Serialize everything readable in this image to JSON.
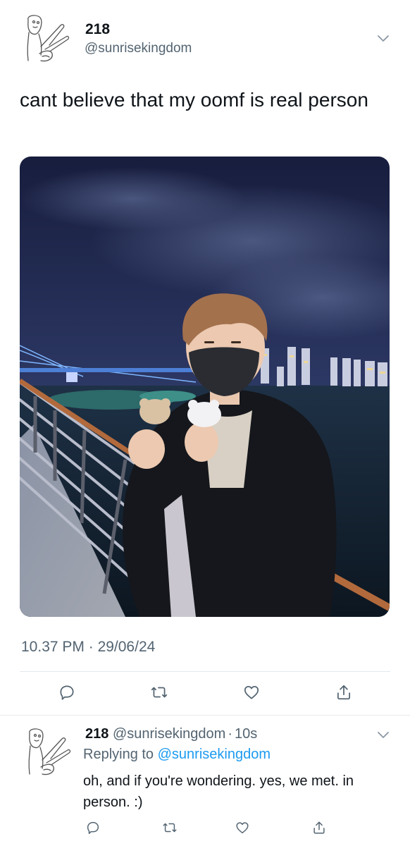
{
  "tweet": {
    "display_name": "218",
    "handle": "@sunrisekingdom",
    "text": "cant believe that my oomf is real person",
    "time": "10.37 PM",
    "separator": " · ",
    "date": "29/06/24"
  },
  "reply": {
    "display_name": "218",
    "handle": "@sunrisekingdom",
    "dot": "·",
    "age": "10s",
    "replying_prefix": "Replying to",
    "replying_handle": "@sunrisekingdom",
    "text": "oh, and if you're wondering. yes, we met. in person. :)"
  },
  "icons": {
    "avatar": "hand-drawn-peace-sign-avatar",
    "more": "chevron-down-icon",
    "reply": "comment-icon",
    "retweet": "retweet-icon",
    "like": "heart-icon",
    "share": "share-icon"
  },
  "colors": {
    "accent": "#1d9bf0",
    "secondary_text": "#536471",
    "divider": "#e6e9ec"
  }
}
